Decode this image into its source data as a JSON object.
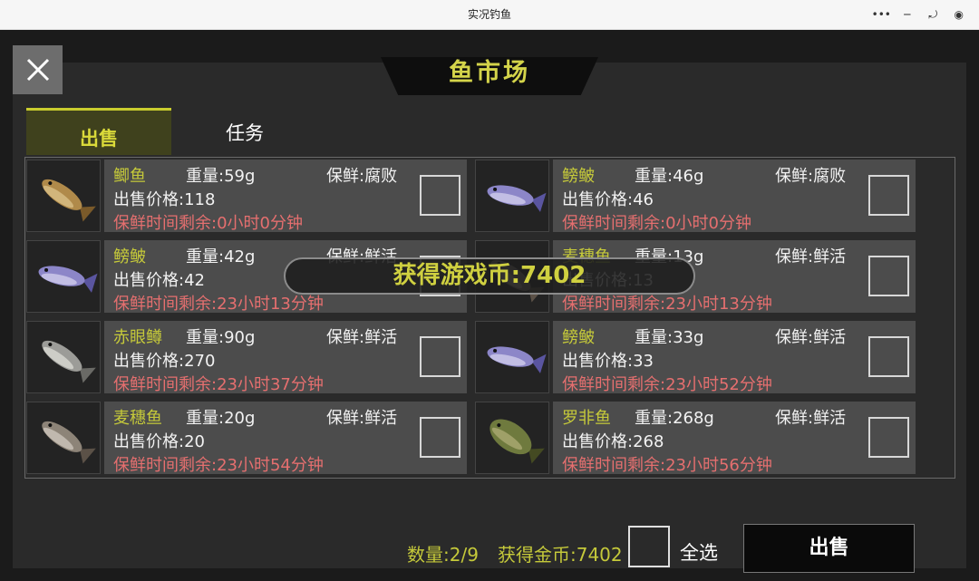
{
  "window": {
    "title": "实况钓鱼",
    "capsule": {
      "more_icon": "more-dots-icon",
      "minimize_icon": "minimize-icon",
      "restore_icon": "restore-icon",
      "record_icon": "record-icon"
    }
  },
  "header": {
    "title": "鱼市场",
    "close_icon": "close-x-icon"
  },
  "tabs": [
    {
      "label": "出售"
    },
    {
      "label": "任务"
    }
  ],
  "fish": [
    {
      "name": "鲫鱼",
      "weight": "重量:59g",
      "fresh": "保鲜:腐败",
      "price": "出售价格:118",
      "remaining": "保鲜时间剩余:0小时0分钟",
      "icon": "crucian-carp-icon"
    },
    {
      "name": "鳑鲏",
      "weight": "重量:46g",
      "fresh": "保鲜:腐败",
      "price": "出售价格:46",
      "remaining": "保鲜时间剩余:0小时0分钟",
      "icon": "bitterling-icon"
    },
    {
      "name": "鳑鲏",
      "weight": "重量:42g",
      "fresh": "保鲜:鲜活",
      "price": "出售价格:42",
      "remaining": "保鲜时间剩余:23小时13分钟",
      "icon": "bitterling-icon"
    },
    {
      "name": "麦穗鱼",
      "weight": "重量:13g",
      "fresh": "保鲜:鲜活",
      "price": "出售价格:13",
      "remaining": "保鲜时间剩余:23小时13分钟",
      "icon": "stone-moroko-icon"
    },
    {
      "name": "赤眼鳟",
      "weight": "重量:90g",
      "fresh": "保鲜:鲜活",
      "price": "出售价格:270",
      "remaining": "保鲜时间剩余:23小时37分钟",
      "icon": "barbel-chub-icon"
    },
    {
      "name": "鳑鲏",
      "weight": "重量:33g",
      "fresh": "保鲜:鲜活",
      "price": "出售价格:33",
      "remaining": "保鲜时间剩余:23小时52分钟",
      "icon": "bitterling-icon"
    },
    {
      "name": "麦穗鱼",
      "weight": "重量:20g",
      "fresh": "保鲜:鲜活",
      "price": "出售价格:20",
      "remaining": "保鲜时间剩余:23小时54分钟",
      "icon": "stone-moroko-icon"
    },
    {
      "name": "罗非鱼",
      "weight": "重量:268g",
      "fresh": "保鲜:鲜活",
      "price": "出售价格:268",
      "remaining": "保鲜时间剩余:23小时56分钟",
      "icon": "tilapia-icon"
    }
  ],
  "toast": {
    "text": "获得游戏币:7402"
  },
  "footer": {
    "quantity": "数量:2/9",
    "gold": "获得金币:7402",
    "select_all": "全选",
    "sell_button": "出售"
  },
  "colors": {
    "accent": "#c5c93a",
    "warning": "#e56f6f",
    "card": "#4c4c4c",
    "panel": "#2a2a2a"
  }
}
